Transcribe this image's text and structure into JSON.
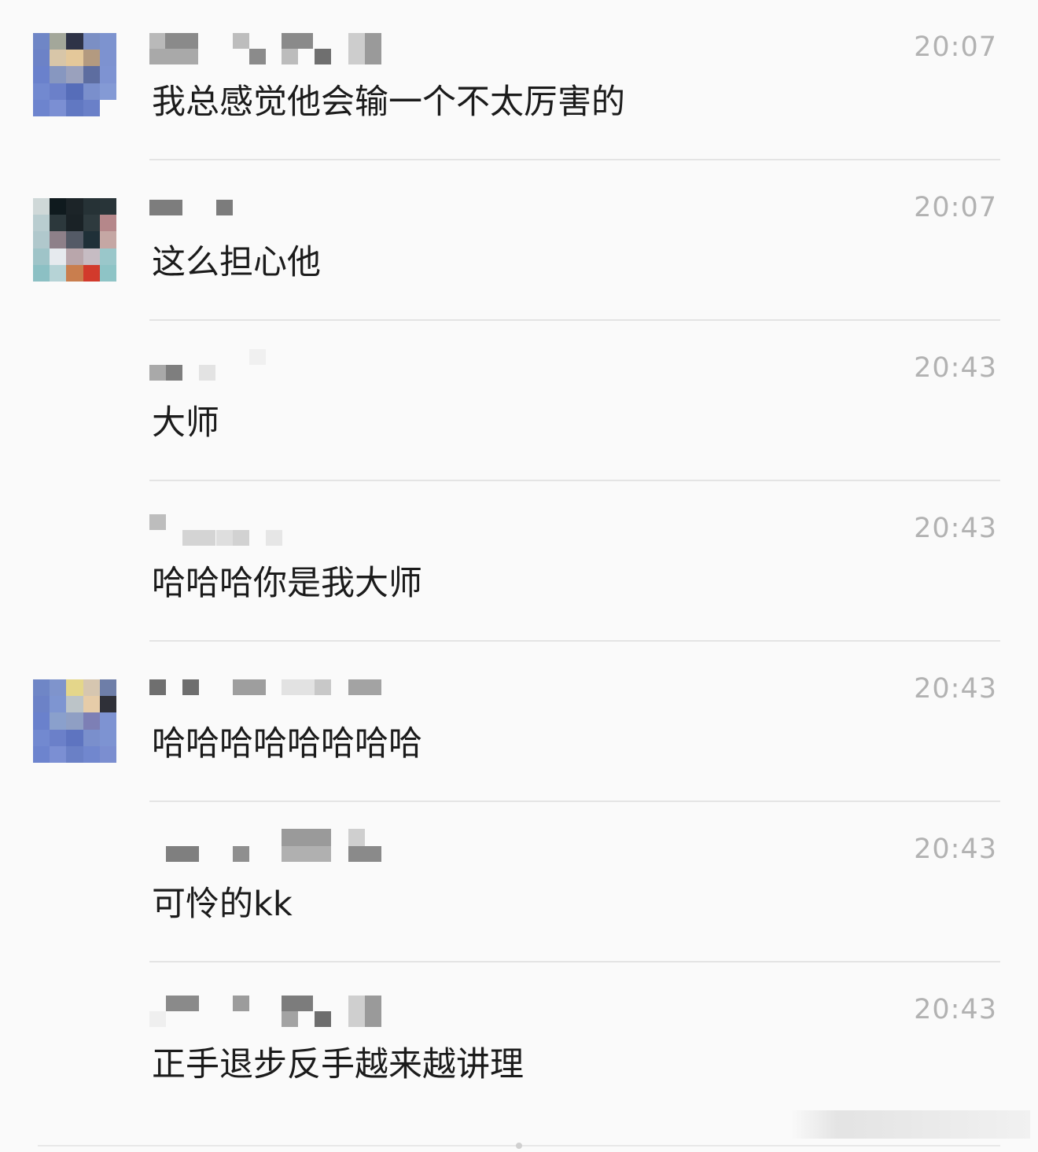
{
  "messages": [
    {
      "time": "20:07",
      "text": "我总感觉他会输一个不太厉害的",
      "has_avatar": true,
      "avatar_colors": [
        "#6f86c6",
        "#a3a79a",
        "#2e3347",
        "#7b8fc4",
        "#7d93cf",
        "#6c82c7",
        "#d8c6a8",
        "#e4c89a",
        "#b39a80",
        "#7d92d0",
        "#6a81cc",
        "#8797c0",
        "#9aa1bd",
        "#5d6da0",
        "#7e93d2",
        "#7289d0",
        "#6b80c9",
        "#566db9",
        "#7a8fcc",
        "#849ad5",
        "#6d84ce",
        "#7b8fd3",
        "#6178c2",
        "#6a80c8",
        "#fafafa"
      ]
    },
    {
      "time": "20:07",
      "text": "这么担心他",
      "has_avatar": true,
      "avatar_colors": [
        "#cfd8d8",
        "#0f1a1e",
        "#1c2428",
        "#263236",
        "#283438",
        "#b9cdd0",
        "#2c383c",
        "#1a2226",
        "#2e3a3e",
        "#b5878a",
        "#b0c8cc",
        "#8e8089",
        "#545a66",
        "#1f3038",
        "#c5a7a4",
        "#9fc4c8",
        "#e6eaee",
        "#b9a6ab",
        "#c6bcc3",
        "#9ac7ca",
        "#8cc0c4",
        "#b6d3d6",
        "#c97e4e",
        "#d23a2c",
        "#8ec4c6"
      ]
    },
    {
      "time": "20:43",
      "text": "大师",
      "has_avatar": false,
      "avatar_colors": []
    },
    {
      "time": "20:43",
      "text": "哈哈哈你是我大师",
      "has_avatar": false,
      "avatar_colors": []
    },
    {
      "time": "20:43",
      "text": "哈哈哈哈哈哈哈哈",
      "has_avatar": true,
      "avatar_colors": [
        "#6f86c6",
        "#7f94cc",
        "#e4d68a",
        "#d6c6b0",
        "#6e7ea8",
        "#6c82c7",
        "#7e95d1",
        "#bcc4c8",
        "#e6cca8",
        "#2f3038",
        "#6a81cc",
        "#8aa0cc",
        "#8f9fc4",
        "#7d7fb5",
        "#7e93d2",
        "#7289d0",
        "#6b80c9",
        "#5e74c0",
        "#7a8fcc",
        "#7d93d2",
        "#6d84ce",
        "#7b8fd3",
        "#6a80c6",
        "#7187ce",
        "#7b8ed0"
      ]
    },
    {
      "time": "20:43",
      "text": "可怜的kk",
      "has_avatar": false,
      "avatar_colors": []
    },
    {
      "time": "20:43",
      "text": "正手退步反手越来越讲理",
      "has_avatar": false,
      "avatar_colors": []
    }
  ]
}
